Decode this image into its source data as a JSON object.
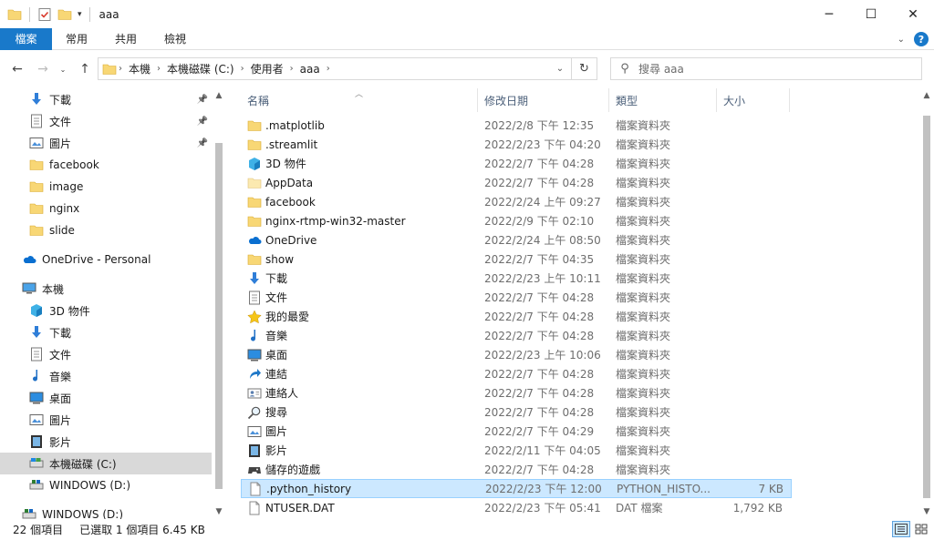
{
  "window": {
    "title": "aaa",
    "minimize": "─",
    "maximize": "☐",
    "close": "✕"
  },
  "ribbon": {
    "tabs": [
      "檔案",
      "常用",
      "共用",
      "檢視"
    ]
  },
  "address": {
    "crumbs": [
      "本機",
      "本機磁碟 (C:)",
      "使用者",
      "aaa"
    ],
    "search_placeholder": "搜尋 aaa"
  },
  "nav": {
    "items": [
      {
        "label": "下載",
        "icon": "download-icon",
        "pinned": true
      },
      {
        "label": "文件",
        "icon": "document-icon",
        "pinned": true
      },
      {
        "label": "圖片",
        "icon": "pictures-icon",
        "pinned": true
      },
      {
        "label": "facebook",
        "icon": "folder-icon"
      },
      {
        "label": "image",
        "icon": "folder-icon"
      },
      {
        "label": "nginx",
        "icon": "folder-icon"
      },
      {
        "label": "slide",
        "icon": "folder-icon"
      },
      {
        "label": "OneDrive - Personal",
        "icon": "onedrive-icon"
      },
      {
        "label": "本機",
        "icon": "computer-icon"
      },
      {
        "label": "3D 物件",
        "icon": "3d-objects-icon"
      },
      {
        "label": "下載",
        "icon": "download-icon"
      },
      {
        "label": "文件",
        "icon": "document-icon"
      },
      {
        "label": "音樂",
        "icon": "music-icon"
      },
      {
        "label": "桌面",
        "icon": "desktop-icon"
      },
      {
        "label": "圖片",
        "icon": "pictures-icon"
      },
      {
        "label": "影片",
        "icon": "videos-icon"
      },
      {
        "label": "本機磁碟 (C:)",
        "icon": "drive-icon",
        "selected": true
      },
      {
        "label": "WINDOWS (D:)",
        "icon": "network-drive-icon"
      },
      {
        "label": "WINDOWS (D:)",
        "icon": "network-drive-icon"
      }
    ]
  },
  "columns": {
    "name": "名稱",
    "modified": "修改日期",
    "type": "類型",
    "size": "大小"
  },
  "files": [
    {
      "name": ".matplotlib",
      "date": "2022/2/8 下午 12:35",
      "type": "檔案資料夾",
      "size": "",
      "icon": "folder-icon"
    },
    {
      "name": ".streamlit",
      "date": "2022/2/23 下午 04:20",
      "type": "檔案資料夾",
      "size": "",
      "icon": "folder-icon"
    },
    {
      "name": "3D 物件",
      "date": "2022/2/7 下午 04:28",
      "type": "檔案資料夾",
      "size": "",
      "icon": "3d-objects-icon"
    },
    {
      "name": "AppData",
      "date": "2022/2/7 下午 04:28",
      "type": "檔案資料夾",
      "size": "",
      "icon": "folder-light-icon"
    },
    {
      "name": "facebook",
      "date": "2022/2/24 上午 09:27",
      "type": "檔案資料夾",
      "size": "",
      "icon": "folder-icon"
    },
    {
      "name": "nginx-rtmp-win32-master",
      "date": "2022/2/9 下午 02:10",
      "type": "檔案資料夾",
      "size": "",
      "icon": "folder-icon"
    },
    {
      "name": "OneDrive",
      "date": "2022/2/24 上午 08:50",
      "type": "檔案資料夾",
      "size": "",
      "icon": "onedrive-icon"
    },
    {
      "name": "show",
      "date": "2022/2/7 下午 04:35",
      "type": "檔案資料夾",
      "size": "",
      "icon": "folder-icon"
    },
    {
      "name": "下載",
      "date": "2022/2/23 上午 10:11",
      "type": "檔案資料夾",
      "size": "",
      "icon": "download-icon"
    },
    {
      "name": "文件",
      "date": "2022/2/7 下午 04:28",
      "type": "檔案資料夾",
      "size": "",
      "icon": "document-icon"
    },
    {
      "name": "我的最愛",
      "date": "2022/2/7 下午 04:28",
      "type": "檔案資料夾",
      "size": "",
      "icon": "favorites-icon"
    },
    {
      "name": "音樂",
      "date": "2022/2/7 下午 04:28",
      "type": "檔案資料夾",
      "size": "",
      "icon": "music-icon"
    },
    {
      "name": "桌面",
      "date": "2022/2/23 上午 10:06",
      "type": "檔案資料夾",
      "size": "",
      "icon": "desktop-icon"
    },
    {
      "name": "連結",
      "date": "2022/2/7 下午 04:28",
      "type": "檔案資料夾",
      "size": "",
      "icon": "links-icon"
    },
    {
      "name": "連絡人",
      "date": "2022/2/7 下午 04:28",
      "type": "檔案資料夾",
      "size": "",
      "icon": "contacts-icon"
    },
    {
      "name": "搜尋",
      "date": "2022/2/7 下午 04:28",
      "type": "檔案資料夾",
      "size": "",
      "icon": "search-icon"
    },
    {
      "name": "圖片",
      "date": "2022/2/7 下午 04:29",
      "type": "檔案資料夾",
      "size": "",
      "icon": "pictures-icon"
    },
    {
      "name": "影片",
      "date": "2022/2/11 下午 04:05",
      "type": "檔案資料夾",
      "size": "",
      "icon": "videos-icon"
    },
    {
      "name": "儲存的遊戲",
      "date": "2022/2/7 下午 04:28",
      "type": "檔案資料夾",
      "size": "",
      "icon": "saved-games-icon"
    },
    {
      "name": ".python_history",
      "date": "2022/2/23 下午 12:00",
      "type": "PYTHON_HISTO...",
      "size": "7 KB",
      "icon": "file-icon",
      "selected": true
    },
    {
      "name": "NTUSER.DAT",
      "date": "2022/2/23 下午 05:41",
      "type": "DAT 檔案",
      "size": "1,792 KB",
      "icon": "file-icon"
    }
  ],
  "status": {
    "count": "22 個項目",
    "selected": "已選取 1 個項目  6.45 KB"
  },
  "colors": {
    "accent": "#1979ca",
    "selection": "#cce8ff",
    "folder": "#f8d775"
  }
}
